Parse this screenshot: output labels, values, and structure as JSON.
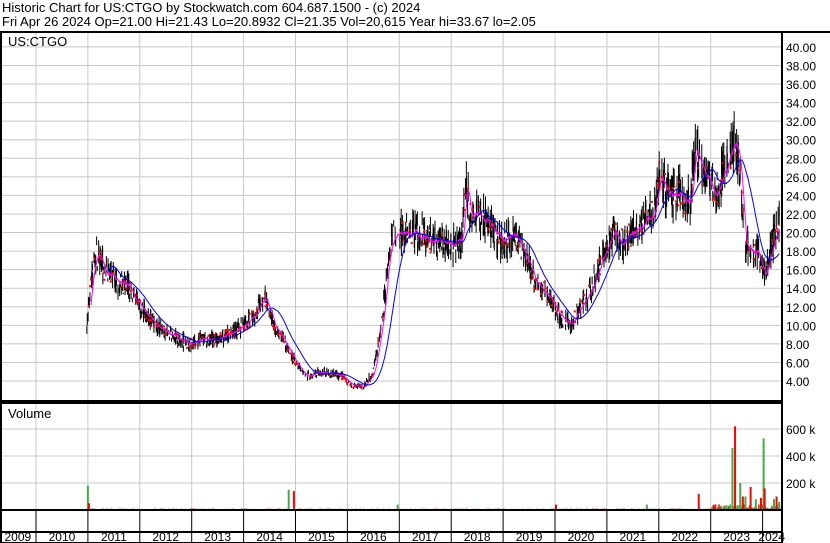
{
  "header": {
    "line1": "Historic Chart for US:CTGO by Stockwatch.com 604.687.1500 - (c) 2024",
    "line2": "Fri Apr 26 2024  Op=21.00  Hi=21.43  Lo=20.8932  Cl=21.35  Vol=20,615  Year hi=33.67  lo=2.05"
  },
  "chart_data": {
    "type": "line",
    "symbol_label": "US:CTGO",
    "volume_label": "Volume",
    "price_ticks": [
      "4.00",
      "6.00",
      "8.00",
      "10.00",
      "12.00",
      "14.00",
      "16.00",
      "18.00",
      "20.00",
      "22.00",
      "24.00",
      "26.00",
      "28.00",
      "30.00",
      "32.00",
      "34.00",
      "36.00",
      "38.00",
      "40.00"
    ],
    "price_range": [
      2.0,
      41.6
    ],
    "volume_ticks": [
      "200 k",
      "400 k",
      "600 k"
    ],
    "volume_range": [
      0,
      800000
    ],
    "years": [
      "2009",
      "2010",
      "2011",
      "2012",
      "2013",
      "2014",
      "2015",
      "2016",
      "2017",
      "2018",
      "2019",
      "2020",
      "2021",
      "2022",
      "2023",
      "2024"
    ],
    "x_range_years": [
      2009.3,
      2024.35
    ],
    "colors": {
      "bars": "#000000",
      "close": "#ff0000",
      "ma_short": "#ff00ff",
      "ma_long": "#0000ff",
      "vol_up": "#44aa44",
      "vol_down": "#ff0000",
      "grid": "#c8c8c8"
    },
    "series_price_anchor": {
      "t": [
        2010.98,
        2011.05,
        2011.15,
        2011.3,
        2011.5,
        2011.8,
        2012.0,
        2012.3,
        2012.6,
        2012.9,
        2013.2,
        2013.5,
        2013.9,
        2014.2,
        2014.4,
        2014.6,
        2014.8,
        2015.0,
        2015.2,
        2015.5,
        2015.9,
        2016.1,
        2016.3,
        2016.5,
        2016.6,
        2016.7,
        2016.8,
        2016.9,
        2017.0,
        2017.3,
        2017.6,
        2017.9,
        2018.2,
        2018.28,
        2018.35,
        2018.5,
        2018.7,
        2019.0,
        2019.2,
        2019.4,
        2019.6,
        2019.9,
        2020.1,
        2020.3,
        2020.5,
        2020.7,
        2020.9,
        2021.1,
        2021.3,
        2021.5,
        2021.7,
        2021.9,
        2022.0,
        2022.2,
        2022.4,
        2022.6,
        2022.7,
        2022.9,
        2023.1,
        2023.3,
        2023.45,
        2023.55,
        2023.65,
        2023.75,
        2023.9,
        2024.05,
        2024.15,
        2024.25,
        2024.32
      ],
      "close": [
        10,
        14,
        18,
        16,
        15,
        14,
        12,
        10,
        9,
        8,
        8.5,
        8.5,
        9.5,
        11,
        13,
        10,
        8,
        6,
        4.5,
        5,
        4.5,
        3.5,
        3.3,
        5,
        8,
        12,
        18,
        20,
        20,
        20,
        19,
        19,
        19,
        26,
        22,
        22,
        21,
        19,
        20,
        18,
        15,
        13,
        11,
        10,
        12,
        14,
        17,
        20,
        19,
        20,
        21,
        22,
        26,
        24,
        24,
        23,
        29,
        26,
        24,
        27,
        30,
        28,
        19,
        18,
        18,
        15,
        18,
        20,
        21.35
      ]
    },
    "series_volume_spikes": {
      "t": [
        2010.98,
        2011.0,
        2014.85,
        2014.95,
        2016.95,
        2020.0,
        2021.75,
        2022.75,
        2023.4,
        2023.45,
        2023.55,
        2023.6,
        2023.65,
        2023.75,
        2023.85,
        2023.95,
        2024.0,
        2024.02,
        2024.2,
        2024.25,
        2024.3
      ],
      "volume": [
        180000,
        50000,
        150000,
        140000,
        40000,
        40000,
        40000,
        120000,
        460000,
        620000,
        200000,
        100000,
        100000,
        170000,
        80000,
        90000,
        530000,
        160000,
        80000,
        100000,
        60000
      ]
    }
  }
}
